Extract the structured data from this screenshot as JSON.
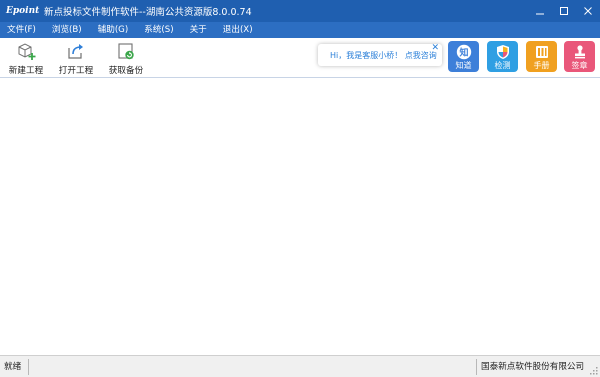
{
  "window": {
    "logo": "Epoint",
    "title": "新点投标文件制作软件--湖南公共资源版8.0.0.74"
  },
  "menu": [
    "文件(F)",
    "浏览(B)",
    "辅助(G)",
    "系统(S)",
    "关于",
    "退出(X)"
  ],
  "toolbar": {
    "new_project": "新建工程",
    "open_project": "打开工程",
    "get_backup": "获取备份"
  },
  "chat": {
    "text": "Hi，我是客服小桥！ 点我咨询",
    "close": "✕"
  },
  "tiles": {
    "zhidao": "知道",
    "jiance": "检测",
    "shouce": "手册",
    "qianzhang": "签章",
    "zhidao_glyph": "知"
  },
  "status": {
    "left": "就绪",
    "right": "国泰新点软件股份有限公司"
  },
  "colors": {
    "titlebar": "#1f5fb0",
    "menubar": "#2c6ec2",
    "tile_zhidao": "#3d7fd9",
    "tile_jiance": "#2f9fe3",
    "tile_shouce": "#f0a020",
    "tile_qianzhang": "#e9577a",
    "chat_text": "#2a7fd8"
  },
  "icons": {
    "new_project": "cube-plus-icon",
    "open_project": "open-arrow-icon",
    "get_backup": "refresh-box-icon",
    "jiance": "shield-icon",
    "shouce": "book-icon",
    "qianzhang": "stamp-icon"
  }
}
